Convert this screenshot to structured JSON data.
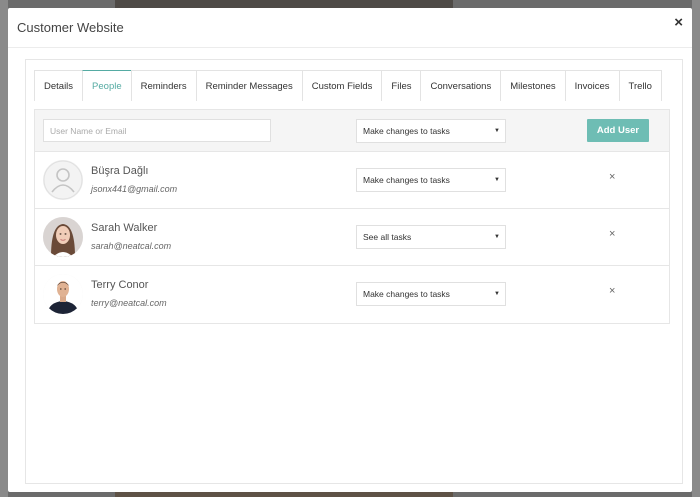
{
  "modal": {
    "title": "Customer Website",
    "close_glyph": "×"
  },
  "tabs": [
    {
      "label": "Details",
      "active": false
    },
    {
      "label": "People",
      "active": true
    },
    {
      "label": "Reminders",
      "active": false
    },
    {
      "label": "Reminder Messages",
      "active": false
    },
    {
      "label": "Custom Fields",
      "active": false
    },
    {
      "label": "Files",
      "active": false
    },
    {
      "label": "Conversations",
      "active": false
    },
    {
      "label": "Milestones",
      "active": false
    },
    {
      "label": "Invoices",
      "active": false
    },
    {
      "label": "Trello",
      "active": false
    }
  ],
  "add_user": {
    "input_placeholder": "User Name or Email",
    "permission": "Make changes to tasks",
    "button_label": "Add User"
  },
  "people": [
    {
      "name": "Büşra Dağlı",
      "email": "jsonx441@gmail.com",
      "permission": "Make changes to tasks",
      "avatar": "default-avatar"
    },
    {
      "name": "Sarah Walker",
      "email": "sarah@neatcal.com",
      "permission": "See all tasks",
      "avatar": "photo-avatar"
    },
    {
      "name": "Terry Conor",
      "email": "terry@neatcal.com",
      "permission": "Make changes to tasks",
      "avatar": "photo-avatar"
    }
  ],
  "icons": {
    "caret": "▼",
    "remove": "×"
  },
  "colors": {
    "accent": "#55aba3",
    "add_button": "#6ebdb4"
  }
}
